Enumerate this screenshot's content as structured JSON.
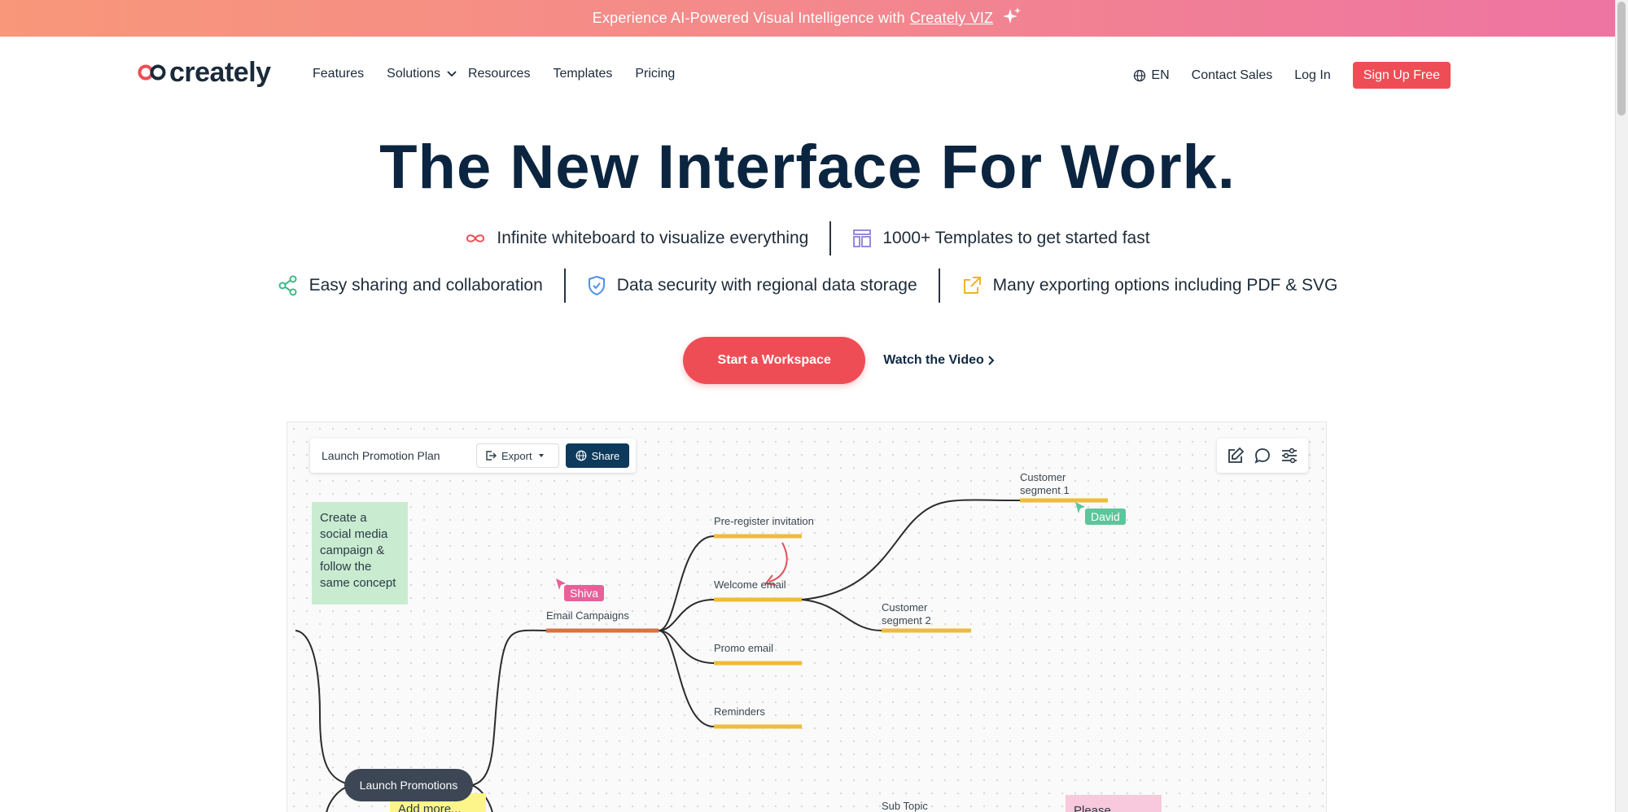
{
  "banner": {
    "text": "Experience AI-Powered Visual Intelligence with",
    "link": "Creately VIZ"
  },
  "nav": {
    "logo": "creately",
    "links": [
      "Features",
      "Solutions",
      "Resources",
      "Templates",
      "Pricing"
    ],
    "lang": "EN",
    "contact": "Contact Sales",
    "login": "Log In",
    "signup": "Sign Up Free"
  },
  "hero": {
    "title": "The New Interface For Work.",
    "features_row1": [
      "Infinite whiteboard to visualize everything",
      "1000+ Templates to get started fast"
    ],
    "features_row2": [
      "Easy sharing and collaboration",
      "Data security with regional data storage",
      "Many exporting options including PDF & SVG"
    ],
    "cta_primary": "Start a Workspace",
    "cta_secondary": "Watch the Video"
  },
  "colors": {
    "accent": "#ef4d56",
    "navy": "#0b2540",
    "share": "#0d3a5c"
  },
  "canvas": {
    "doc_title": "Launch Promotion Plan",
    "export": "Export",
    "share": "Share",
    "sticky_green": "Create a social media campaign & follow the same concept",
    "sticky_yellow": "Add more...",
    "sticky_pink": "Please follow...",
    "nodes": {
      "email_campaigns": "Email Campaigns",
      "pre_register": "Pre-register invitation",
      "welcome": "Welcome email",
      "promo": "Promo email",
      "reminders": "Reminders",
      "seg1_line1": "Customer",
      "seg1_line2": "segment 1",
      "seg2_line1": "Customer",
      "seg2_line2": "segment 2",
      "sub_topic": "Sub Topic",
      "launch": "Launch Promotions"
    },
    "users": [
      "Shiva",
      "David"
    ]
  }
}
